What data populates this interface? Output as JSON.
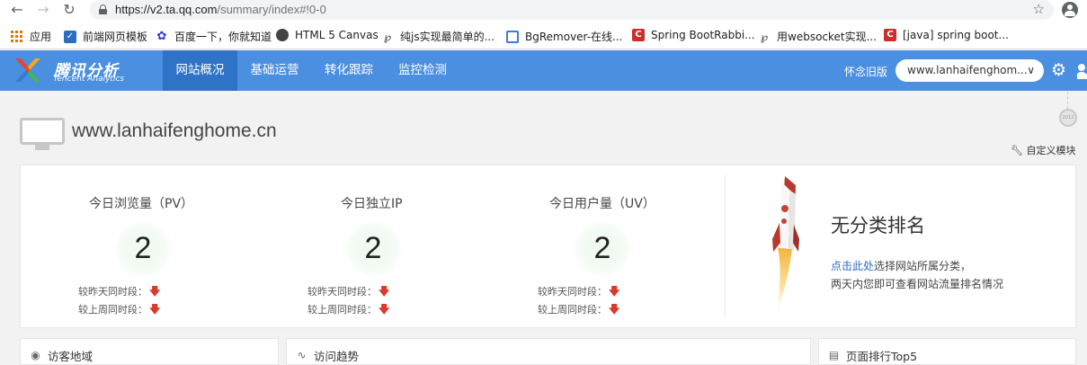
{
  "browser": {
    "url_host": "https://v2.ta.qq.com",
    "url_path": "/summary/index#!0-0",
    "bookmarks": [
      {
        "label": "应用",
        "icon": "apps-grid-icon",
        "color": "#e37400"
      },
      {
        "label": "前端网页模板",
        "icon": "template-icon",
        "color": "#2b6cc4"
      },
      {
        "label": "百度一下，你就知道",
        "icon": "baidu-paw-icon",
        "color": "#2932e1"
      },
      {
        "label": "HTML 5 Canvas",
        "icon": "globe-icon",
        "color": "#444444"
      },
      {
        "label": "纯js实现最简单的...",
        "icon": "script-icon",
        "color": "#555555"
      },
      {
        "label": "BgRemover-在线...",
        "icon": "image-icon",
        "color": "#3c7be0"
      },
      {
        "label": "Spring BootRabbi...",
        "icon": "csdn-icon",
        "color": "#c9302c"
      },
      {
        "label": "用websocket实现...",
        "icon": "script-icon",
        "color": "#555555"
      },
      {
        "label": "[java] spring boot...",
        "icon": "csdn-icon",
        "color": "#c9302c"
      }
    ]
  },
  "header": {
    "logo_cn": "腾讯分析",
    "logo_en": "Tencent Analytics",
    "nav": [
      "网站概况",
      "基础运营",
      "转化跟踪",
      "监控检测"
    ],
    "active_nav": "网站概况",
    "old_version": "怀念旧版",
    "site_select": "www.lanhaifenghom...",
    "brand_color": "#4a8fe0"
  },
  "page": {
    "site_title": "www.lanhaifenghome.cn",
    "custom_module": "自定义模块",
    "badge": "2012"
  },
  "stats": [
    {
      "title": "今日浏览量（PV）",
      "value": "2",
      "cmp_day": "较昨天同时段：",
      "cmp_week": "较上周同时段：",
      "trend": "down"
    },
    {
      "title": "今日独立IP",
      "value": "2",
      "cmp_day": "较昨天同时段：",
      "cmp_week": "较上周同时段：",
      "trend": "down"
    },
    {
      "title": "今日用户量（UV）",
      "value": "2",
      "cmp_day": "较昨天同时段：",
      "cmp_week": "较上周同时段：",
      "trend": "down"
    }
  ],
  "ranking": {
    "title": "无分类排名",
    "link_text": "点击此处",
    "line1_rest": "选择网站所属分类，",
    "line2": "两天内您即可查看网站流量排名情况"
  },
  "panels": [
    {
      "title": "访客地域",
      "icon": "globe-icon"
    },
    {
      "title": "访问趋势",
      "icon": "trend-line-icon"
    },
    {
      "title": "页面排行Top5",
      "icon": "ranking-list-icon"
    }
  ],
  "colors": {
    "down_arrow": "#d93a2b",
    "link": "#2b6cc4"
  }
}
